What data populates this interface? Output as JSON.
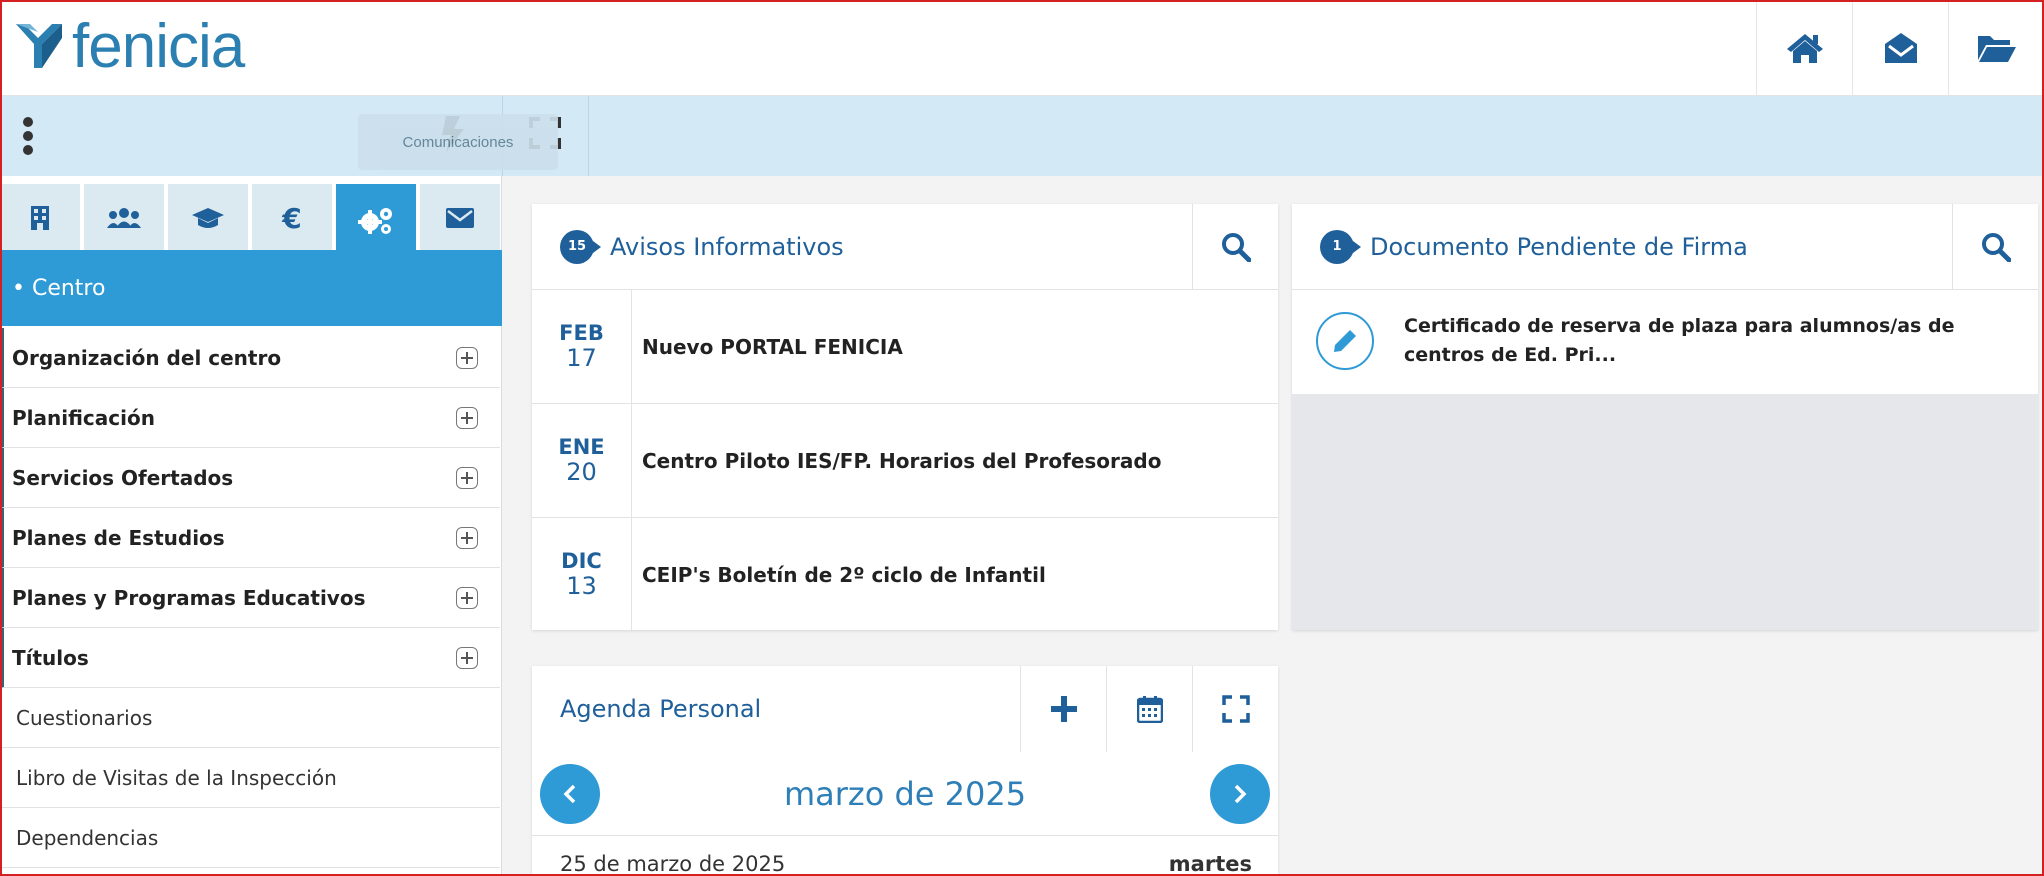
{
  "app": {
    "name": "fenicia",
    "brand_color": "#2e9ad6",
    "accent_dark": "#1f5f9a"
  },
  "header": {
    "buttons": [
      {
        "icon": "home-icon"
      },
      {
        "icon": "envelope-open-icon"
      },
      {
        "icon": "folder-open-icon"
      }
    ]
  },
  "toolbar": {
    "tooltip": "Comunicaciones",
    "icons": [
      "vertical-dots-icon",
      "bolt-icon",
      "expand-icon"
    ]
  },
  "sidebar": {
    "tabs": [
      {
        "icon": "building-icon"
      },
      {
        "icon": "users-icon"
      },
      {
        "icon": "graduation-cap-icon"
      },
      {
        "icon": "euro-icon",
        "glyph": "€"
      },
      {
        "icon": "gears-icon",
        "active": true
      },
      {
        "icon": "envelope-icon"
      }
    ],
    "section_title": "• Centro",
    "items": [
      {
        "label": "Organización del centro",
        "expandable": true
      },
      {
        "label": "Planificación",
        "expandable": true
      },
      {
        "label": "Servicios Ofertados",
        "expandable": true
      },
      {
        "label": "Planes de Estudios",
        "expandable": true
      },
      {
        "label": "Planes y Programas Educativos",
        "expandable": true
      },
      {
        "label": "Títulos",
        "expandable": true
      },
      {
        "label": "Cuestionarios",
        "expandable": false
      },
      {
        "label": "Libro de Visitas de la Inspección",
        "expandable": false
      },
      {
        "label": "Dependencias",
        "expandable": false
      }
    ]
  },
  "avisos": {
    "badge": "15",
    "title": "Avisos Informativos",
    "items": [
      {
        "month": "FEB",
        "day": "17",
        "text": "Nuevo PORTAL FENICIA"
      },
      {
        "month": "ENE",
        "day": "20",
        "text": "Centro Piloto IES/FP. Horarios del Profesorado"
      },
      {
        "month": "DIC",
        "day": "13",
        "text": "CEIP's Boletín de 2º ciclo de Infantil"
      }
    ]
  },
  "documento": {
    "badge": "1",
    "title": "Documento Pendiente de Firma",
    "line1": "Certificado de reserva de plaza para alumnos/as de",
    "line2": "centros de Ed. Pri..."
  },
  "agenda": {
    "title": "Agenda Personal",
    "month": "marzo de 2025",
    "day_label": "25 de marzo de 2025",
    "weekday": "martes"
  }
}
